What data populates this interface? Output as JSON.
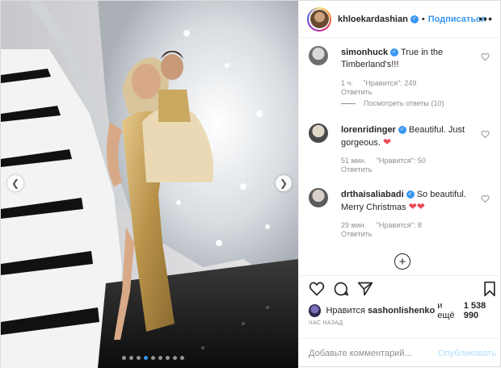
{
  "post": {
    "author": "khloekardashian",
    "follow_label": "Подписаться",
    "more_label": "•••"
  },
  "comments": [
    {
      "user": "simonhuck",
      "text": "True in the Timberland's!!!",
      "age": "1 ч.",
      "likes": "\"Нравится\": 249",
      "reply_label": "Ответить",
      "view_replies": "Посмотреть ответы (10)"
    },
    {
      "user": "lorenridinger",
      "text": "Beautiful. Just gorgeous.",
      "age": "51 мин.",
      "likes": "\"Нравится\": 50",
      "reply_label": "Ответить"
    },
    {
      "user": "drthaisaliabadi",
      "text": "So beautiful. Merry Christmas",
      "age": "29 мин.",
      "likes": "\"Нравится\": 8",
      "reply_label": "Ответить"
    }
  ],
  "likes_bar": {
    "prefix": "Нравится",
    "user": "sashonlishenko",
    "and": "и ещё",
    "count": "1 538 990"
  },
  "timestamp": "ЧАС НАЗАД",
  "composer": {
    "placeholder": "Добавьте комментарий...",
    "publish_label": "Опубликовать"
  },
  "carousel": {
    "total": 9,
    "active": 3
  },
  "icons": {
    "prev": "chevron-left-icon",
    "next": "chevron-right-icon",
    "like": "heart-icon",
    "comment": "comment-bubble-icon",
    "share": "paper-plane-icon",
    "save": "bookmark-icon",
    "load_more": "plus-circle-icon",
    "verified": "verified-badge-icon"
  },
  "colors": {
    "accent": "#3897f0",
    "heart": "#ed4956",
    "muted": "#8e8e8e",
    "publish_disabled": "#b2dffc"
  }
}
